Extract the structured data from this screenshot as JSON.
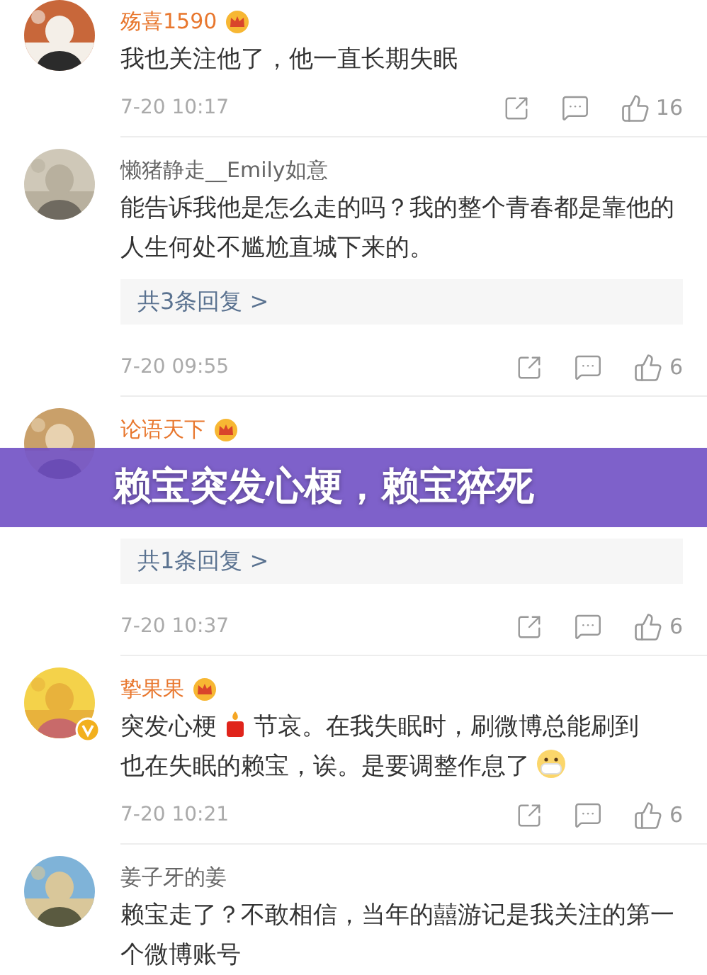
{
  "comments": [
    {
      "user": "殇喜1590",
      "vip": true,
      "body": [
        [
          {
            "kind": "text",
            "text": "我也关注他了，他一直长期失眠"
          }
        ]
      ],
      "time": "7-20 10:17",
      "likes": "16"
    },
    {
      "user": "懒猪静走__Emily如意",
      "vip": false,
      "body": [
        [
          {
            "kind": "text",
            "text": "能告诉我他是怎么走的吗？我的整个青春都是靠他的人生何处不尴尬直城下来的。"
          }
        ]
      ],
      "replies": "共3条回复 >",
      "time": "7-20 09:55",
      "likes": "6"
    },
    {
      "user": "论语天下",
      "vip": true,
      "covered": true,
      "replies": "共1条回复 >",
      "time": "7-20 10:37",
      "likes": "6"
    },
    {
      "user": "挚果果",
      "vip": true,
      "verified": {
        "color": "#f2b01e"
      },
      "body": [
        [
          {
            "kind": "text",
            "text": "突发心梗"
          },
          {
            "kind": "candle"
          },
          {
            "kind": "text",
            "text": "节哀。在我失眠时，刷微博总能刷到"
          }
        ],
        [
          {
            "kind": "text",
            "text": "也在失眠的赖宝，诶。是要调整作息了"
          },
          {
            "kind": "mask"
          }
        ]
      ],
      "time": "7-20 10:21",
      "likes": "6"
    },
    {
      "user": "姜子牙的姜",
      "vip": false,
      "body": [
        [
          {
            "kind": "text",
            "text": "赖宝走了？不敢相信，当年的囍游记是我关注的第一个微博账号"
          }
        ]
      ]
    }
  ],
  "banner": {
    "title": "赖宝突发心梗，赖宝猝死"
  }
}
